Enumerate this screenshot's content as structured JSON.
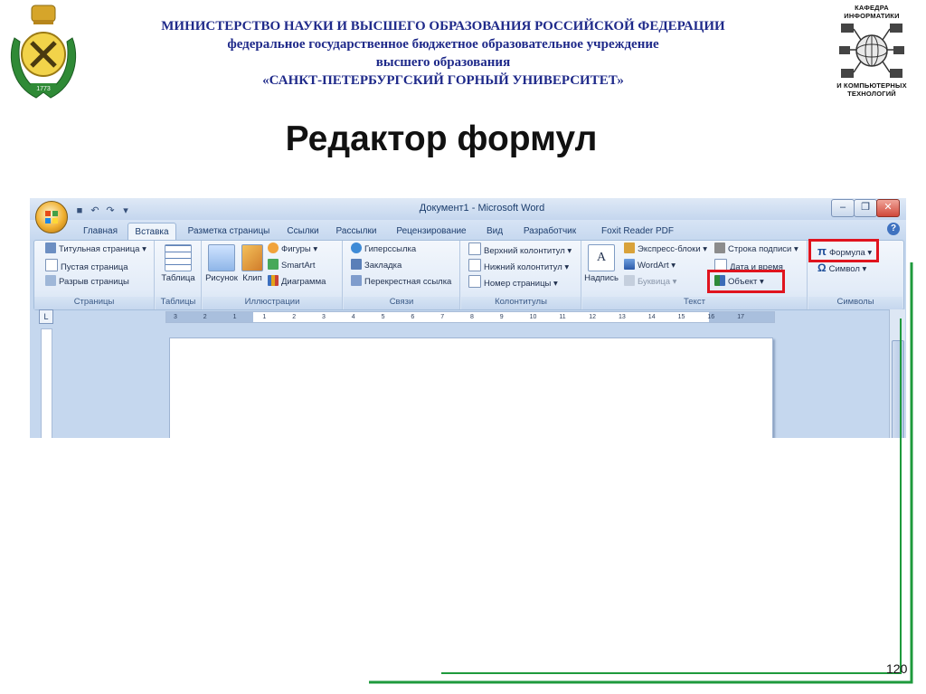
{
  "header": {
    "ministry": "МИНИСТЕРСТВО НАУКИ И ВЫСШЕГО ОБРАЗОВАНИЯ РОССИЙСКОЙ ФЕДЕРАЦИИ",
    "institution_type": "федеральное государственное бюджетное образовательное учреждение",
    "education_level": "высшего образования",
    "university": "«САНКТ-ПЕТЕРБУРГСКИЙ ГОРНЫЙ УНИВЕРСИТЕТ»",
    "department_top": [
      "КАФЕДРА",
      "ИНФОРМАТИКИ"
    ],
    "department_bottom": [
      "И КОМПЬЮТЕРНЫХ",
      "ТЕХНОЛОГИЙ"
    ],
    "emblem_year": "1773"
  },
  "slide": {
    "title": "Редактор формул",
    "page_number": "120"
  },
  "word": {
    "window_title": "Документ1 - Microsoft Word",
    "tabs": [
      {
        "label": "Главная"
      },
      {
        "label": "Вставка",
        "active": true
      },
      {
        "label": "Разметка страницы"
      },
      {
        "label": "Ссылки"
      },
      {
        "label": "Рассылки"
      },
      {
        "label": "Рецензирование"
      },
      {
        "label": "Вид"
      },
      {
        "label": "Разработчик"
      },
      {
        "label": "Foxit Reader PDF"
      }
    ],
    "groups": {
      "pages": {
        "label": "Страницы",
        "cover_page": "Титульная страница",
        "blank_page": "Пустая страница",
        "page_break": "Разрыв страницы"
      },
      "tables": {
        "label": "Таблицы",
        "table": "Таблица"
      },
      "illustrations": {
        "label": "Иллюстрации",
        "picture": "Рисунок",
        "clip": "Клип",
        "shapes": "Фигуры",
        "smartart": "SmartArt",
        "chart": "Диаграмма"
      },
      "links": {
        "label": "Связи",
        "hyperlink": "Гиперссылка",
        "bookmark": "Закладка",
        "cross_reference": "Перекрестная ссылка"
      },
      "header_footer": {
        "label": "Колонтитулы",
        "header": "Верхний колонтитул",
        "footer": "Нижний колонтитул",
        "page_number": "Номер страницы"
      },
      "text": {
        "label": "Текст",
        "textbox": "Надпись",
        "quick_parts": "Экспресс-блоки",
        "wordart": "WordArt",
        "dropcap": "Буквица",
        "signature_line": "Строка подписи",
        "date_time": "Дата и время",
        "object": "Объект"
      },
      "symbols": {
        "label": "Символы",
        "equation": "Формула",
        "symbol": "Символ"
      }
    },
    "ruler_marks": [
      "3",
      "2",
      "1",
      "1",
      "2",
      "3",
      "4",
      "5",
      "6",
      "7",
      "8",
      "9",
      "10",
      "11",
      "12",
      "13",
      "14",
      "15",
      "16",
      "17"
    ]
  },
  "colors": {
    "header_text": "#1f2a8a",
    "highlight": "#e0141e",
    "accent_green": "#1e9a3c",
    "ribbon_bg": "#dfe9f6"
  }
}
